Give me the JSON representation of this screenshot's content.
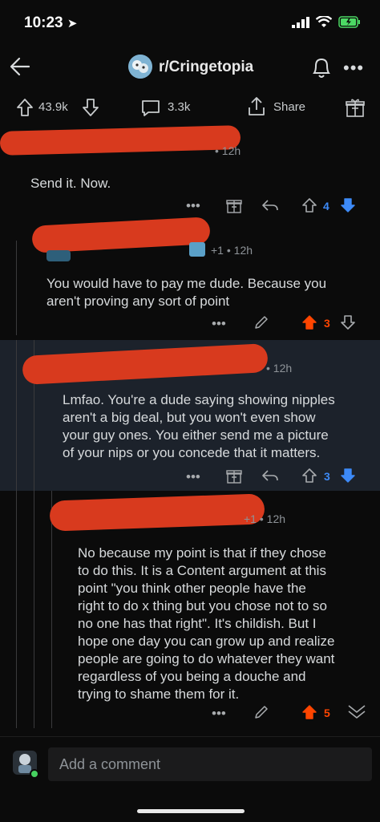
{
  "status": {
    "time": "10:23"
  },
  "nav": {
    "subreddit": "r/Cringetopia"
  },
  "post_actions": {
    "upvotes": "43.9k",
    "comments": "3.3k",
    "share_label": "Share"
  },
  "comments": [
    {
      "time": "12h",
      "body": "Send it. Now.",
      "score": "4",
      "vote": "down"
    },
    {
      "karma": "+1",
      "time": "12h",
      "body_lines": [
        "You would have to pay me dude. Because you",
        "aren't proving any sort of point"
      ],
      "score": "3",
      "vote": "up"
    },
    {
      "time": "12h",
      "body_lines": [
        "Lmfao. You're a dude saying showing nipples",
        "aren't a big deal, but you won't even show",
        "your guy ones. You either send me a picture",
        "of your nips or you concede that it matters."
      ],
      "score": "3",
      "vote": "down"
    },
    {
      "karma": "+1",
      "time": "12h",
      "body_lines": [
        "No because my point is that if they chose",
        "to do this. It is a Content argument at this",
        "point \"you think other people have the",
        "right to do x thing but you chose not to so",
        "no one has that right\". It's childish. But I",
        "hope one day you can grow up and realize",
        "people are going to do whatever they want",
        "regardless of you being a douche and",
        "trying to shame them for it."
      ],
      "score": "5",
      "vote": "up"
    }
  ],
  "composer": {
    "placeholder": "Add a comment"
  },
  "colors": {
    "upvote": "#ff4500",
    "downvote": "#3d8af7",
    "redaction": "#d83a1e",
    "highlight": "#1c222b"
  }
}
